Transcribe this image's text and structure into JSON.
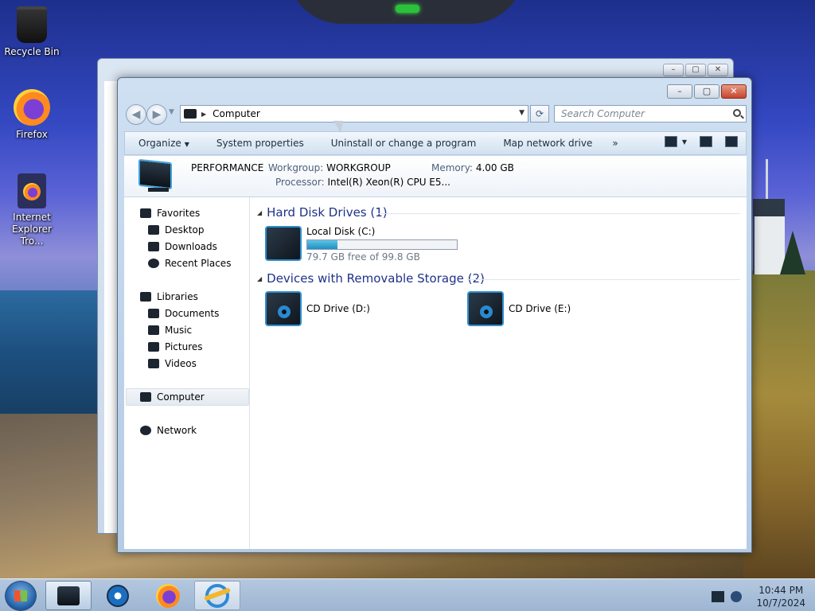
{
  "desktop": {
    "icons": [
      {
        "label": "Recycle Bin",
        "icon": "recycle-bin-icon"
      },
      {
        "label": "Firefox",
        "icon": "firefox-icon"
      },
      {
        "label": "Internet Explorer Tro...",
        "icon": "internet-explorer-icon"
      }
    ]
  },
  "window": {
    "address": {
      "location": "Computer"
    },
    "search": {
      "placeholder": "Search Computer"
    },
    "commands": [
      "Organize",
      "System properties",
      "Uninstall or change a program",
      "Map network drive"
    ],
    "more": "»",
    "info": {
      "computer_name": "PERFORMANCE",
      "workgroup_label": "Workgroup:",
      "workgroup_value": "WORKGROUP",
      "memory_label": "Memory:",
      "memory_value": "4.00 GB",
      "processor_label": "Processor:",
      "processor_value": "Intel(R) Xeon(R) CPU E5..."
    },
    "nav": {
      "favorites": "Favorites",
      "desktop": "Desktop",
      "downloads": "Downloads",
      "recent_places": "Recent Places",
      "libraries": "Libraries",
      "documents": "Documents",
      "music": "Music",
      "pictures": "Pictures",
      "videos": "Videos",
      "computer": "Computer",
      "network": "Network"
    },
    "groups": {
      "hard_disk": {
        "title": "Hard Disk Drives (1)"
      },
      "removable": {
        "title": "Devices with Removable Storage (2)"
      }
    },
    "drives": {
      "local_c": {
        "name": "Local Disk (C:)",
        "free_text": "79.7 GB free of 99.8 GB",
        "used_fraction": 0.2
      },
      "cd_d": {
        "name": "CD Drive (D:)"
      },
      "cd_e": {
        "name": "CD Drive (E:)"
      }
    }
  },
  "taskbar": {
    "clock": {
      "time": "10:44 PM",
      "date": "10/7/2024"
    }
  }
}
